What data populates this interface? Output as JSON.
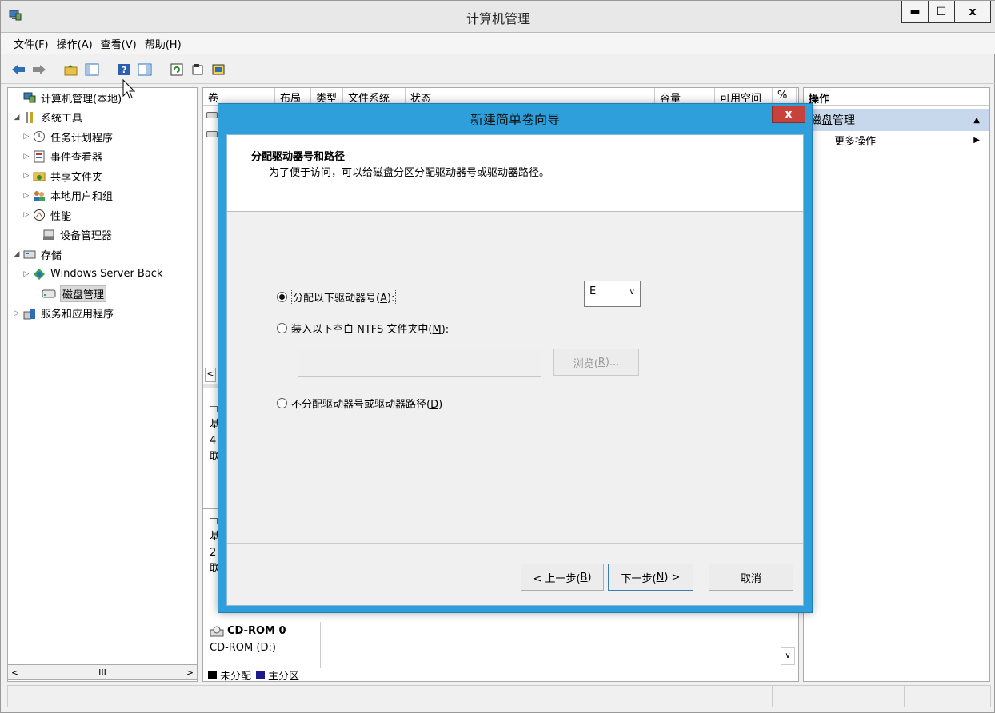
{
  "window": {
    "title": "计算机管理",
    "controls": {
      "minimize": "▬",
      "maximize": "☐",
      "close": "x"
    }
  },
  "menu": [
    "文件(F)",
    "操作(A)",
    "查看(V)",
    "帮助(H)"
  ],
  "tree": {
    "items": [
      {
        "label": "计算机管理(本地)",
        "arrow": "",
        "icon": "computer-management-icon"
      },
      {
        "label": "系统工具",
        "arrow": "◢",
        "icon": "tools-icon"
      },
      {
        "label": "任务计划程序",
        "arrow": "▷",
        "icon": "clock-icon"
      },
      {
        "label": "事件查看器",
        "arrow": "▷",
        "icon": "event-viewer-icon"
      },
      {
        "label": "共享文件夹",
        "arrow": "▷",
        "icon": "shared-folder-icon"
      },
      {
        "label": "本地用户和组",
        "arrow": "▷",
        "icon": "users-icon"
      },
      {
        "label": "性能",
        "arrow": "▷",
        "icon": "performance-icon"
      },
      {
        "label": "设备管理器",
        "arrow": "",
        "icon": "device-manager-icon"
      },
      {
        "label": "存储",
        "arrow": "◢",
        "icon": "storage-icon"
      },
      {
        "label": "Windows Server Back",
        "arrow": "▷",
        "icon": "backup-icon"
      },
      {
        "label": "磁盘管理",
        "arrow": "",
        "icon": "disk-icon"
      },
      {
        "label": "服务和应用程序",
        "arrow": "▷",
        "icon": "services-icon"
      }
    ],
    "hscroll": {
      "left": "<",
      "mid": "III",
      "right": ">"
    }
  },
  "center": {
    "columns": [
      "卷",
      "布局",
      "类型",
      "文件系统",
      "状态",
      "容量",
      "可用空间",
      "%"
    ],
    "left_scroll": "<",
    "disk_rows": [
      {
        "lines": [
          "基",
          "4",
          "联"
        ]
      },
      {
        "lines": [
          "基",
          "2",
          "联"
        ]
      }
    ],
    "cdrom": {
      "title": "CD-ROM 0",
      "sub": "CD-ROM (D:)"
    },
    "legend": [
      {
        "label": "未分配",
        "color": "#000000"
      },
      {
        "label": "主分区",
        "color": "#1a1a8c"
      }
    ]
  },
  "actions": {
    "header": "操作",
    "section": "磁盘管理",
    "section_arrow": "▲",
    "item": "更多操作",
    "item_arrow": "▶"
  },
  "dialog": {
    "title": "新建简单卷向导",
    "close": "x",
    "header_title": "分配驱动器号和路径",
    "header_desc": "为了便于访问，可以给磁盘分区分配驱动器号或驱动器路径。",
    "option_assign": {
      "prefix": "分配以下驱动器号(",
      "key": "A",
      "suffix": "):"
    },
    "drive_letter": "E",
    "option_mount": {
      "prefix": "装入以下空白 NTFS 文件夹中(",
      "key": "M",
      "suffix": "):"
    },
    "browse": {
      "prefix": "浏览(",
      "key": "R",
      "suffix": ")..."
    },
    "option_none": {
      "prefix": "不分配驱动器号或驱动器路径(",
      "key": "D",
      "suffix": ")"
    },
    "back": {
      "prefix": "< 上一步(",
      "key": "B",
      "suffix": ")"
    },
    "next": {
      "prefix": "下一步(",
      "key": "N",
      "suffix": ") >"
    },
    "cancel": "取消"
  },
  "colors": {
    "dialog_border": "#2e9fdb",
    "selection": "#c8d8ec",
    "close_red": "#c7423a"
  }
}
